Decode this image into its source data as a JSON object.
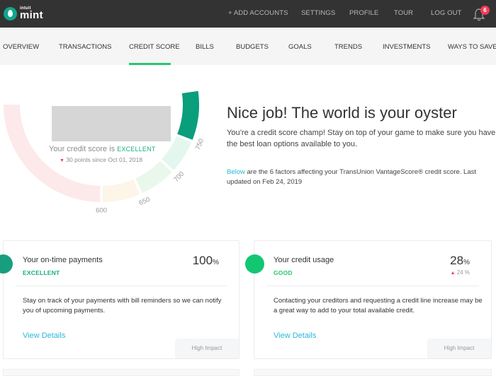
{
  "app": {
    "logo_brand": "intuit",
    "logo_name": "mint",
    "logo_icon": "droplet-icon"
  },
  "top_nav": {
    "items": [
      {
        "label": "+ ADD ACCOUNTS"
      },
      {
        "label": "SETTINGS"
      },
      {
        "label": "PROFILE"
      },
      {
        "label": "TOUR"
      },
      {
        "label": "LOG OUT"
      }
    ],
    "notifications_icon": "bell-icon",
    "notifications_count": "6"
  },
  "sub_nav": {
    "active": "CREDIT SCORE",
    "items": [
      {
        "label": "OVERVIEW"
      },
      {
        "label": "TRANSACTIONS"
      },
      {
        "label": "CREDIT SCORE"
      },
      {
        "label": "BILLS"
      },
      {
        "label": "BUDGETS"
      },
      {
        "label": "GOALS"
      },
      {
        "label": "TRENDS"
      },
      {
        "label": "INVESTMENTS"
      },
      {
        "label": "WAYS TO SAVE"
      }
    ]
  },
  "gauge": {
    "score_prefix": "Your credit score is",
    "score_status": "EXCELLENT",
    "change_arrow": "▼",
    "change_text": "30 points since Oct 01, 2018",
    "tick_labels": [
      "600",
      "650",
      "700",
      "750"
    ],
    "segments": [
      {
        "from": 300,
        "to": 600,
        "color": "#fde9ea"
      },
      {
        "from": 600,
        "to": 650,
        "color": "#fdf5e8"
      },
      {
        "from": 650,
        "to": 700,
        "color": "#eaf8ec"
      },
      {
        "from": 700,
        "to": 750,
        "color": "#e3f7ef"
      },
      {
        "from": 750,
        "to": 850,
        "color": "#0a9e7c"
      }
    ]
  },
  "hero": {
    "title": "Nice job! The world is your oyster",
    "subtitle": "You’re a credit score champ! Stay on top of your game to make sure you have the best loan options available to you.",
    "note_link": "Below",
    "note_text": " are the 6 factors affecting your TransUnion VantageScore® credit score. Last updated on Feb 24, 2019"
  },
  "factors": [
    {
      "title": "Your on-time payments",
      "status": "EXCELLENT",
      "status_color": "#1aae86",
      "dot_color": "#179e7e",
      "value": "100",
      "unit": "%",
      "delta": "",
      "description": "Stay on track of your payments with bill reminders so we can notify you of upcoming payments.",
      "link": "View Details",
      "impact": "High Impact"
    },
    {
      "title": "Your credit usage",
      "status": "GOOD",
      "status_color": "#28c76f",
      "dot_color": "#13c672",
      "value": "28",
      "unit": "%",
      "delta_arrow": "▲",
      "delta": "24 %",
      "description": "Contacting your creditors and requesting a credit line increase may be a great way to add to your total available credit.",
      "link": "View Details",
      "impact": "High Impact"
    }
  ]
}
